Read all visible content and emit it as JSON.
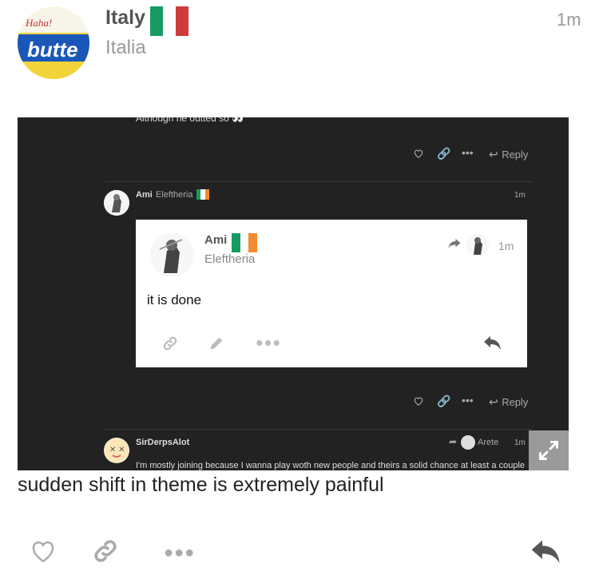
{
  "post": {
    "username": "Italy",
    "user_title": "Italia",
    "time": "1m",
    "avatar_text": "butte",
    "avatar_small_text": "Haha!",
    "caption": "sudden shift in theme is extremely painful"
  },
  "screenshot": {
    "cut_text": "Although he outted so",
    "reply_label": "Reply",
    "reply2": {
      "name": "Ami",
      "title": "Eleftheria",
      "time": "1m"
    },
    "quote": {
      "name": "Ami",
      "title": "Eleftheria",
      "time": "1m",
      "text": "it is done"
    },
    "reply3": {
      "name": "SirDerpsAlot",
      "reply_to": "Arete",
      "time": "1m",
      "text": "I'm mostly joining because I wanna play woth new people and theirs a solid chance at least a couple"
    }
  },
  "colors": {
    "italy_flag": [
      "#169b62",
      "#ffffff",
      "#cd3b3b"
    ],
    "ireland_flag": [
      "#169b62",
      "#ffffff",
      "#f28a2f"
    ],
    "dark_bg": "#222222"
  }
}
